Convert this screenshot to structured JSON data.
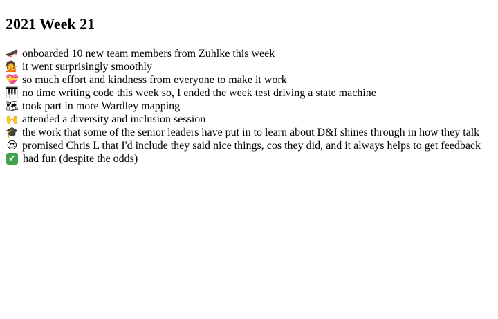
{
  "page": {
    "title": "2021 Week 21",
    "items": [
      {
        "icon": "skateboard-icon",
        "glyph": "🛹",
        "text": "onboarded 10 new team members from Zuhlke this week"
      },
      {
        "icon": "person-tipping-hand-icon",
        "glyph": "💁",
        "text": "it went surprisingly smoothly"
      },
      {
        "icon": "heart-with-ribbon-icon",
        "glyph": "💝",
        "text": "so much effort and kindness from everyone to make it work"
      },
      {
        "icon": "musical-keyboard-icon",
        "glyph": "🎹",
        "text": "no time writing code this week so, I ended the week test driving a state machine"
      },
      {
        "icon": "world-map-icon",
        "glyph": "🗺",
        "text": "took part in more Wardley mapping"
      },
      {
        "icon": "raising-hands-icon",
        "glyph": "🙌",
        "text": "attended a diversity and inclusion session"
      },
      {
        "icon": "graduation-cap-icon",
        "glyph": "🎓",
        "text": "the work that some of the senior leaders have put in to learn about D&I shines through in how they talk"
      },
      {
        "icon": "heart-eyes-face-icon",
        "glyph": "😍",
        "text": "promised Chris L that I'd include they said nice things, cos they did, and it always helps to get feedback"
      },
      {
        "icon": "check-mark-button-icon",
        "glyph": "✔",
        "text": "had fun (despite the odds)"
      }
    ]
  }
}
